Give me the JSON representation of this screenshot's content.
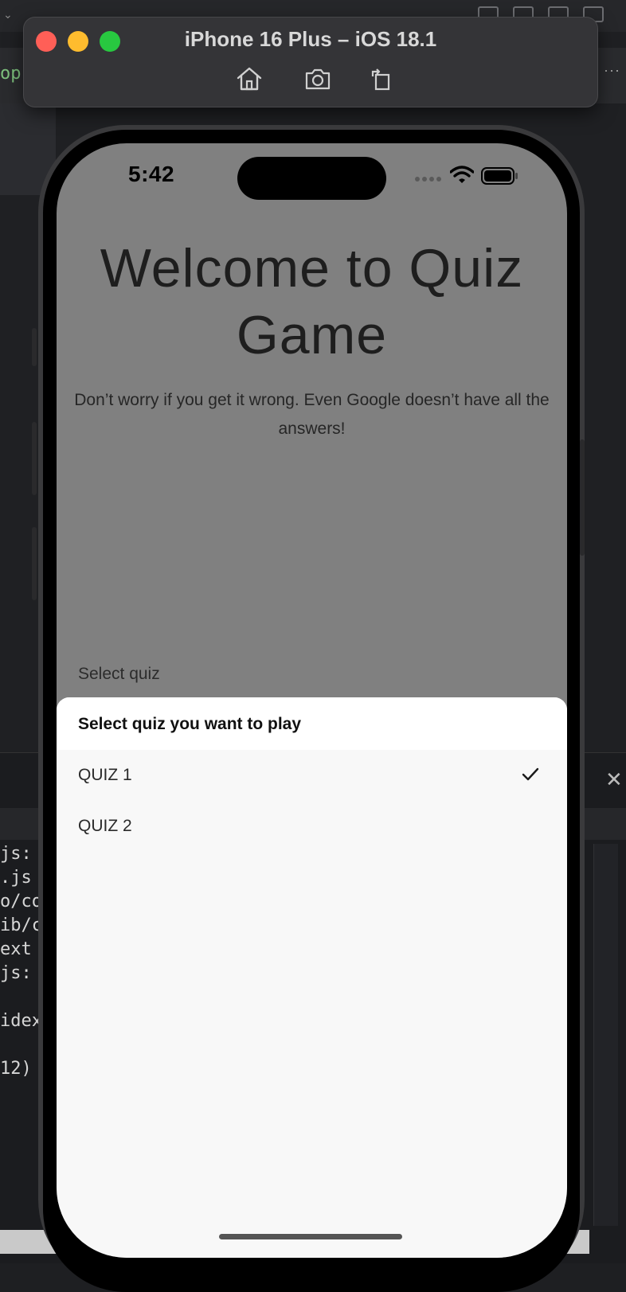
{
  "simulator": {
    "title": "iPhone 16 Plus – iOS 18.1",
    "tools": [
      "home-icon",
      "camera-icon",
      "rotate-icon"
    ]
  },
  "ide": {
    "top_label": "op",
    "code_lines": [
      "js:",
      ".js",
      "o/co",
      "ib/c",
      "ext",
      "js:",
      "",
      "idex",
      "",
      "12)"
    ]
  },
  "status_bar": {
    "time": "5:42"
  },
  "app": {
    "title": "Welcome to Quiz Game",
    "subtitle": "Don’t worry if you get it wrong. Even Google doesn’t have all the answers!",
    "select_label": "Select quiz"
  },
  "sheet": {
    "title": "Select quiz you want to play",
    "options": [
      {
        "label": "QUIZ 1",
        "selected": true
      },
      {
        "label": "QUIZ 2",
        "selected": false
      }
    ]
  },
  "colors": {
    "overlay": "#808080",
    "sheet_bg": "#f8f8f8",
    "traffic_red": "#ff5f57",
    "traffic_yellow": "#febc2e",
    "traffic_green": "#28c840"
  }
}
